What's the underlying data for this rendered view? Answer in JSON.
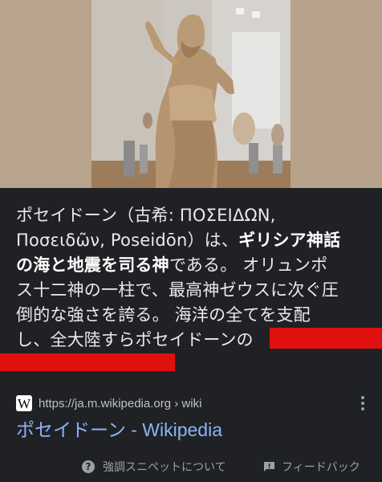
{
  "snippet": {
    "line1": "ポセイドーン（古希: ΠΟΣΕΙΔΩΝ,",
    "line2a": "Ποσειδῶν, Poseidōn）は、",
    "line2b_bold": "ギリシア神話",
    "line3_bold": "の海と地震を司る神",
    "line3b": "である。 オリュンポ",
    "line4": "ス十二神の一柱で、最高神ゼウスに次ぐ圧",
    "line5": "倒的な強さを誇る。 海洋の全てを支配",
    "line6": "し、全大陸すらポセイドーンの"
  },
  "source": {
    "favicon_letter": "W",
    "url": "https://ja.m.wikipedia.org › wiki"
  },
  "result": {
    "title": "ポセイドーン - Wikipedia"
  },
  "footer": {
    "about_label": "強調スニペットについて",
    "feedback_label": "フィードバック"
  },
  "colors": {
    "background": "#202124",
    "link": "#8ab4f8",
    "text": "#e8eaed",
    "redaction": "#e0100f"
  }
}
